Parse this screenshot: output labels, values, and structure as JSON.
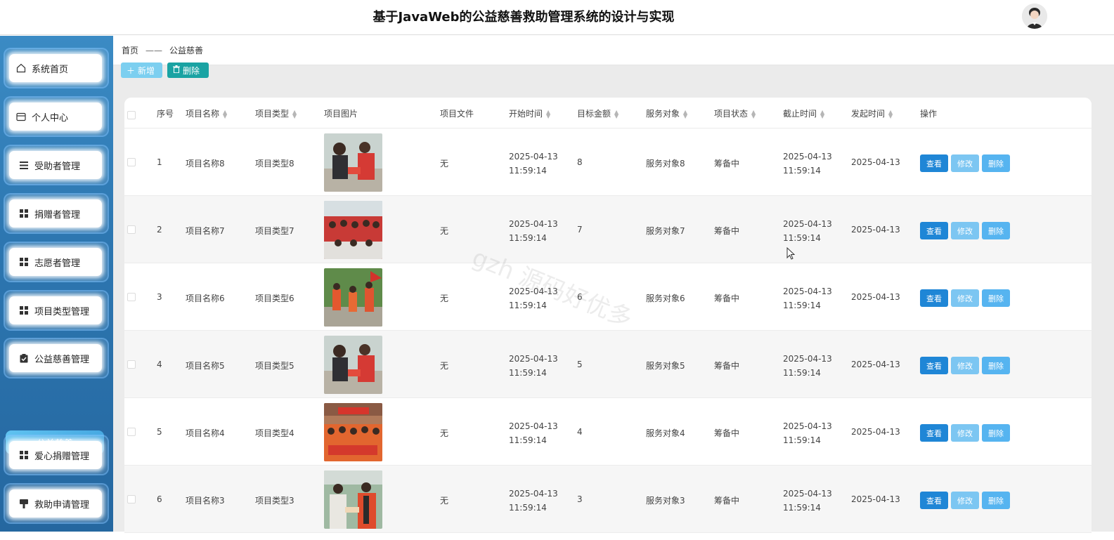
{
  "app": {
    "title": "基于JavaWeb的公益慈善救助管理系统的设计与实现"
  },
  "sidebar": {
    "items": [
      {
        "label": "系统首页",
        "icon": "home-icon"
      },
      {
        "label": "个人中心",
        "icon": "card-icon"
      },
      {
        "label": "受助者管理",
        "icon": "list-icon"
      },
      {
        "label": "捐赠者管理",
        "icon": "grid-icon"
      },
      {
        "label": "志愿者管理",
        "icon": "grid-icon"
      },
      {
        "label": "项目类型管理",
        "icon": "grid-icon"
      },
      {
        "label": "公益慈善管理",
        "icon": "clipboard-icon"
      },
      {
        "label": "爱心捐赠管理",
        "icon": "grid-icon"
      },
      {
        "label": "救助申请管理",
        "icon": "stamp-icon"
      }
    ],
    "active_sub_item": "公益慈善"
  },
  "breadcrumb": {
    "home": "首页",
    "separator": "——",
    "current": "公益慈善"
  },
  "toolbar": {
    "add_label": "新增",
    "delete_label": "删除"
  },
  "table": {
    "columns": [
      "序号",
      "项目名称",
      "项目类型",
      "项目图片",
      "项目文件",
      "开始时间",
      "目标金额",
      "服务对象",
      "项目状态",
      "截止时间",
      "发起时间",
      "操作"
    ],
    "actions": {
      "view": "查看",
      "edit": "修改",
      "delete": "删除"
    },
    "rows": [
      {
        "index": "1",
        "name": "项目名称8",
        "type": "项目类型8",
        "file": "无",
        "start": "2025-04-13 11:59:14",
        "amount": "8",
        "target": "服务对象8",
        "status": "筹备中",
        "deadline": "2025-04-13 11:59:14",
        "created": "2025-04-13"
      },
      {
        "index": "2",
        "name": "项目名称7",
        "type": "项目类型7",
        "file": "无",
        "start": "2025-04-13 11:59:14",
        "amount": "7",
        "target": "服务对象7",
        "status": "筹备中",
        "deadline": "2025-04-13 11:59:14",
        "created": "2025-04-13"
      },
      {
        "index": "3",
        "name": "项目名称6",
        "type": "项目类型6",
        "file": "无",
        "start": "2025-04-13 11:59:14",
        "amount": "6",
        "target": "服务对象6",
        "status": "筹备中",
        "deadline": "2025-04-13 11:59:14",
        "created": "2025-04-13"
      },
      {
        "index": "4",
        "name": "项目名称5",
        "type": "项目类型5",
        "file": "无",
        "start": "2025-04-13 11:59:14",
        "amount": "5",
        "target": "服务对象5",
        "status": "筹备中",
        "deadline": "2025-04-13 11:59:14",
        "created": "2025-04-13"
      },
      {
        "index": "5",
        "name": "项目名称4",
        "type": "项目类型4",
        "file": "无",
        "start": "2025-04-13 11:59:14",
        "amount": "4",
        "target": "服务对象4",
        "status": "筹备中",
        "deadline": "2025-04-13 11:59:14",
        "created": "2025-04-13"
      },
      {
        "index": "6",
        "name": "项目名称3",
        "type": "项目类型3",
        "file": "无",
        "start": "2025-04-13 11:59:14",
        "amount": "3",
        "target": "服务对象3",
        "status": "筹备中",
        "deadline": "2025-04-13 11:59:14",
        "created": "2025-04-13"
      }
    ]
  },
  "watermark": "gzh 源码好优多",
  "colors": {
    "sidebar": "#2d77b1",
    "active_sub": "#47a9e2",
    "view_button": "#1f86d6",
    "edit_button": "#7cc6f2",
    "delete_button": "#56b4f0",
    "batch_delete": "#1aa3a3"
  }
}
